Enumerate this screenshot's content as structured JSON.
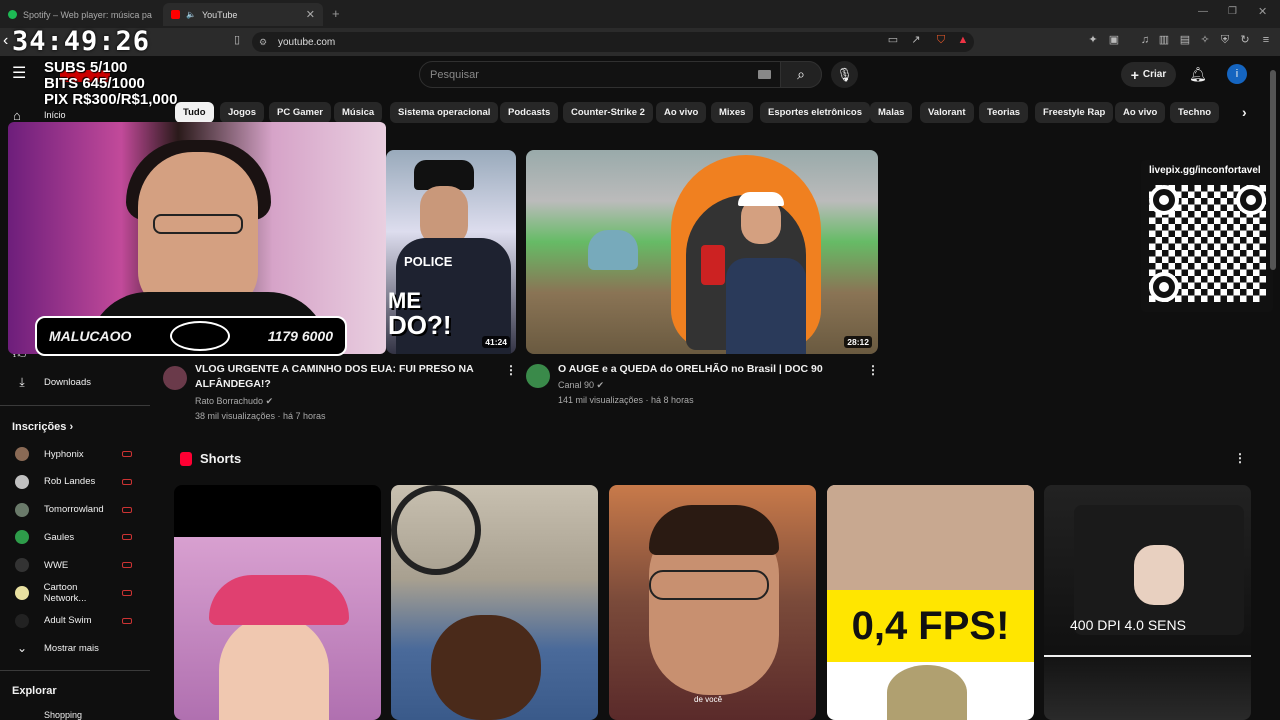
{
  "browser": {
    "tabs": [
      {
        "title": "Spotify – Web player: música para to"
      },
      {
        "title": "YouTube"
      }
    ],
    "url": "youtube.com",
    "timer": "34:49:26"
  },
  "stream_overlay": {
    "subs": "SUBS 5/100",
    "bits": "BITS 645/1000",
    "pix": "PIX R$300/R$1,000",
    "banner_left": "MALUCAOO",
    "banner_right": "1179 6000",
    "qr_label": "livepix.gg/inconfortavel"
  },
  "header": {
    "search_placeholder": "Pesquisar",
    "create_label": "Criar",
    "avatar_letter": "i"
  },
  "chips": [
    "Tudo",
    "Jogos",
    "PC Gamer",
    "Música",
    "Sistema operacional",
    "Podcasts",
    "Counter-Strike 2",
    "Ao vivo",
    "Mixes",
    "Esportes eletrônicos",
    "Malas",
    "Valorant",
    "Teorias",
    "Freestyle Rap",
    "Ao vivo",
    "Techno"
  ],
  "sidebar": {
    "home_label": "Início",
    "downloads_label": "Downloads",
    "subscriptions_title": "Inscrições",
    "subscriptions": [
      {
        "name": "Hyphonix",
        "color": "#8a6a55"
      },
      {
        "name": "Rob Landes",
        "color": "#c0c0c0"
      },
      {
        "name": "Tomorrowland",
        "color": "#6a7a6a"
      },
      {
        "name": "Gaules",
        "color": "#2e9c4a"
      },
      {
        "name": "WWE",
        "color": "#333333"
      },
      {
        "name": "Cartoon Network...",
        "color": "#e8e0a0"
      },
      {
        "name": "Adult Swim",
        "color": "#222222"
      }
    ],
    "show_more": "Mostrar mais",
    "explore_title": "Explorar",
    "shopping": "Shopping"
  },
  "videos": [
    {
      "title_line1": "VLOG URGENTE A CAMINHO DOS EUA: FUI PRESO NA",
      "title_line2": "ALFÂNDEGA!?",
      "channel": "Rato Borrachudo",
      "meta": "38 mil visualizações · há 7 horas",
      "duration": "41:24",
      "thumb_text1": "ME",
      "thumb_text2": "DO?!",
      "badge": "POLICE"
    },
    {
      "title_line1": "O AUGE e a QUEDA do ORELHÃO no Brasil | DOC 90",
      "channel": "Canal 90",
      "meta": "141 mil visualizações · há 8 horas",
      "duration": "28:12"
    }
  ],
  "shorts": {
    "title": "Shorts",
    "items": [
      {
        "caption": ""
      },
      {
        "caption": ""
      },
      {
        "caption": "de você"
      },
      {
        "caption": "0,4 FPS!"
      },
      {
        "caption": "400 DPI 4.0 SENS"
      }
    ]
  }
}
